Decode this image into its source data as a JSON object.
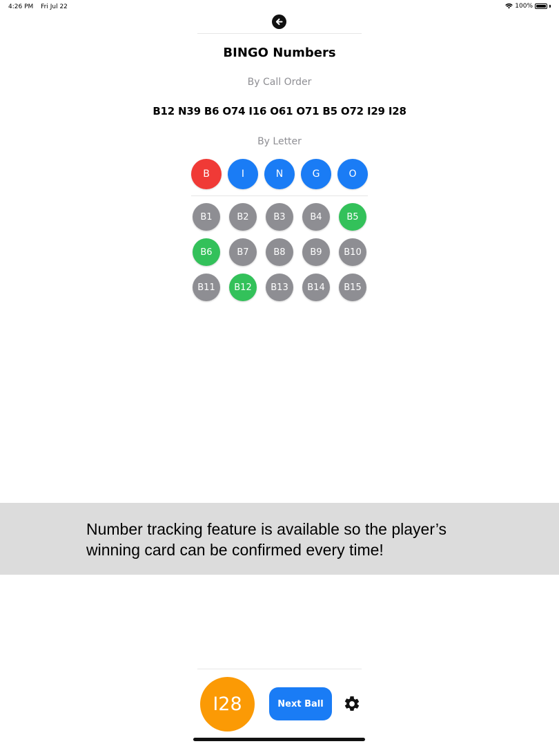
{
  "status_bar": {
    "time": "4:26 PM",
    "date": "Fri Jul 22",
    "battery": "100%"
  },
  "header": {
    "back_icon": "arrow-left-circle-icon",
    "title": "BINGO Numbers"
  },
  "call_order": {
    "label": "By Call Order",
    "sequence": "B12 N39 B6 O74 I16 O61 O71 B5 O72 I29 I28"
  },
  "by_letter": {
    "label": "By Letter",
    "letters": [
      {
        "label": "B",
        "selected": true
      },
      {
        "label": "I",
        "selected": false
      },
      {
        "label": "N",
        "selected": false
      },
      {
        "label": "G",
        "selected": false
      },
      {
        "label": "O",
        "selected": false
      }
    ],
    "numbers": [
      {
        "label": "B1",
        "called": false
      },
      {
        "label": "B2",
        "called": false
      },
      {
        "label": "B3",
        "called": false
      },
      {
        "label": "B4",
        "called": false
      },
      {
        "label": "B5",
        "called": true
      },
      {
        "label": "B6",
        "called": true
      },
      {
        "label": "B7",
        "called": false
      },
      {
        "label": "B8",
        "called": false
      },
      {
        "label": "B9",
        "called": false
      },
      {
        "label": "B10",
        "called": false
      },
      {
        "label": "B11",
        "called": false
      },
      {
        "label": "B12",
        "called": true
      },
      {
        "label": "B13",
        "called": false
      },
      {
        "label": "B14",
        "called": false
      },
      {
        "label": "B15",
        "called": false
      }
    ]
  },
  "banner": {
    "line1": "Number tracking feature is available so the player’s",
    "line2": "winning card can be confirmed every time!"
  },
  "footer": {
    "current_ball": "I28",
    "next_ball_label": "Next Ball",
    "settings_icon": "gear-icon"
  },
  "colors": {
    "selected_letter": "#f03a36",
    "letter": "#1a7cf5",
    "uncalled": "#8e8e93",
    "called": "#33c15a",
    "current_ball": "#fb9a05",
    "button": "#1a7cf5",
    "banner_bg": "#dcdcdc"
  }
}
